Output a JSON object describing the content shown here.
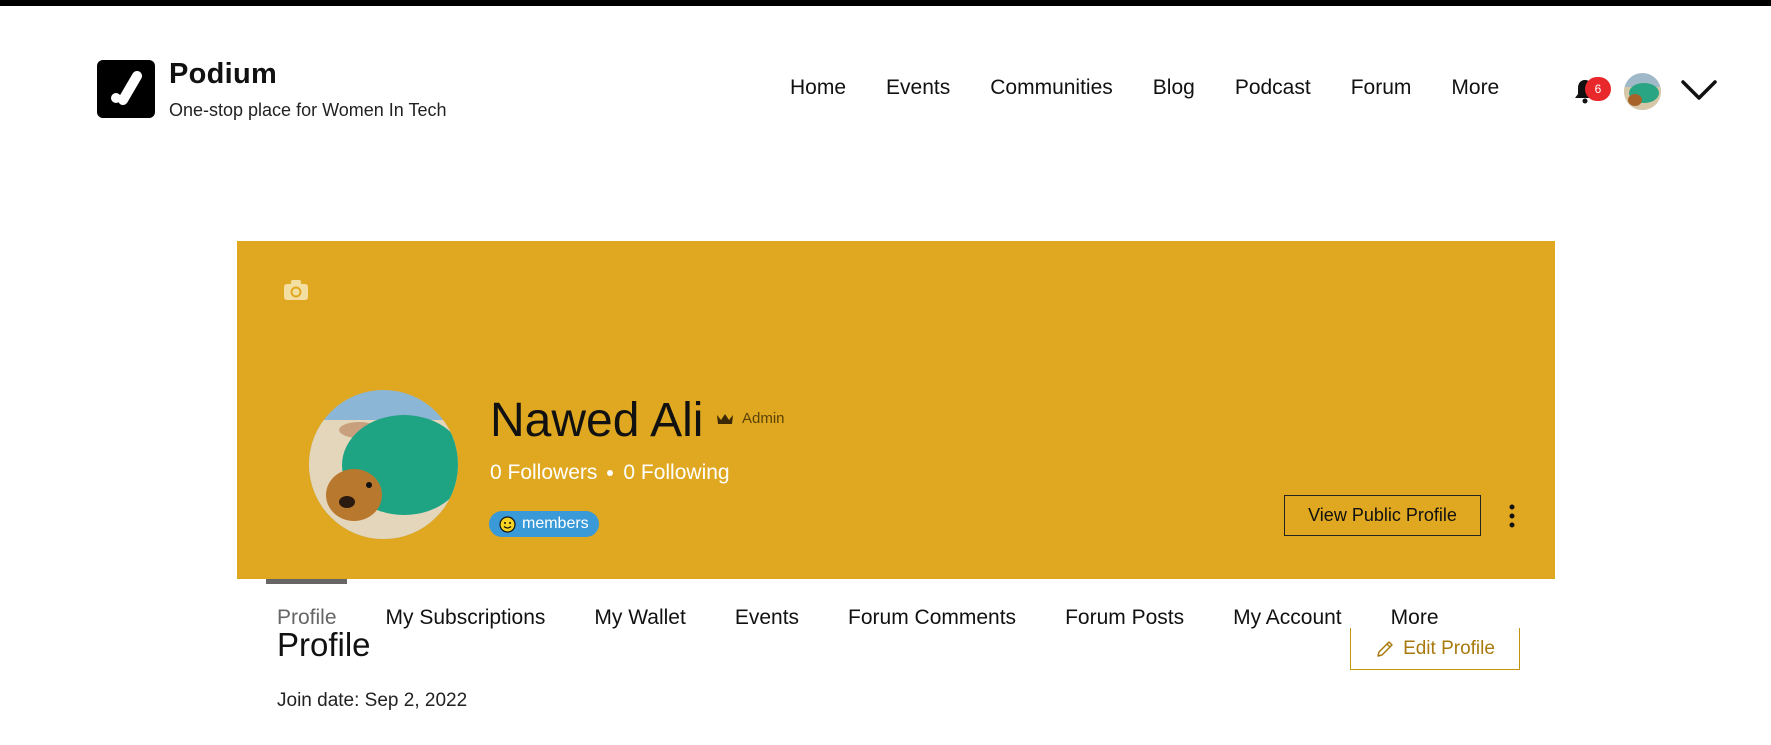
{
  "header": {
    "brand_title": "Podium",
    "brand_subtitle": "One-stop place for Women In Tech",
    "nav": [
      "Home",
      "Events",
      "Communities",
      "Blog",
      "Podcast",
      "Forum",
      "More"
    ],
    "notification_count": "6"
  },
  "profile": {
    "name": "Nawed Ali",
    "role": "Admin",
    "followers_label": "0 Followers",
    "following_label": "0 Following",
    "badge": "members",
    "view_public_profile": "View Public Profile",
    "banner_color": "#e0a820"
  },
  "tabs": [
    "Profile",
    "My Subscriptions",
    "My Wallet",
    "Events",
    "Forum Comments",
    "Forum Posts",
    "My Account",
    "More"
  ],
  "content": {
    "section_title": "Profile",
    "edit_profile": "Edit Profile",
    "join_date": "Join date: Sep 2, 2022"
  },
  "icons": {
    "logo": "check-slash-logo",
    "notification": "bell-icon",
    "dropdown": "chevron-down-icon",
    "cover": "camera-icon",
    "role": "crown-icon",
    "options": "more-vertical-icon",
    "edit": "pencil-icon"
  }
}
